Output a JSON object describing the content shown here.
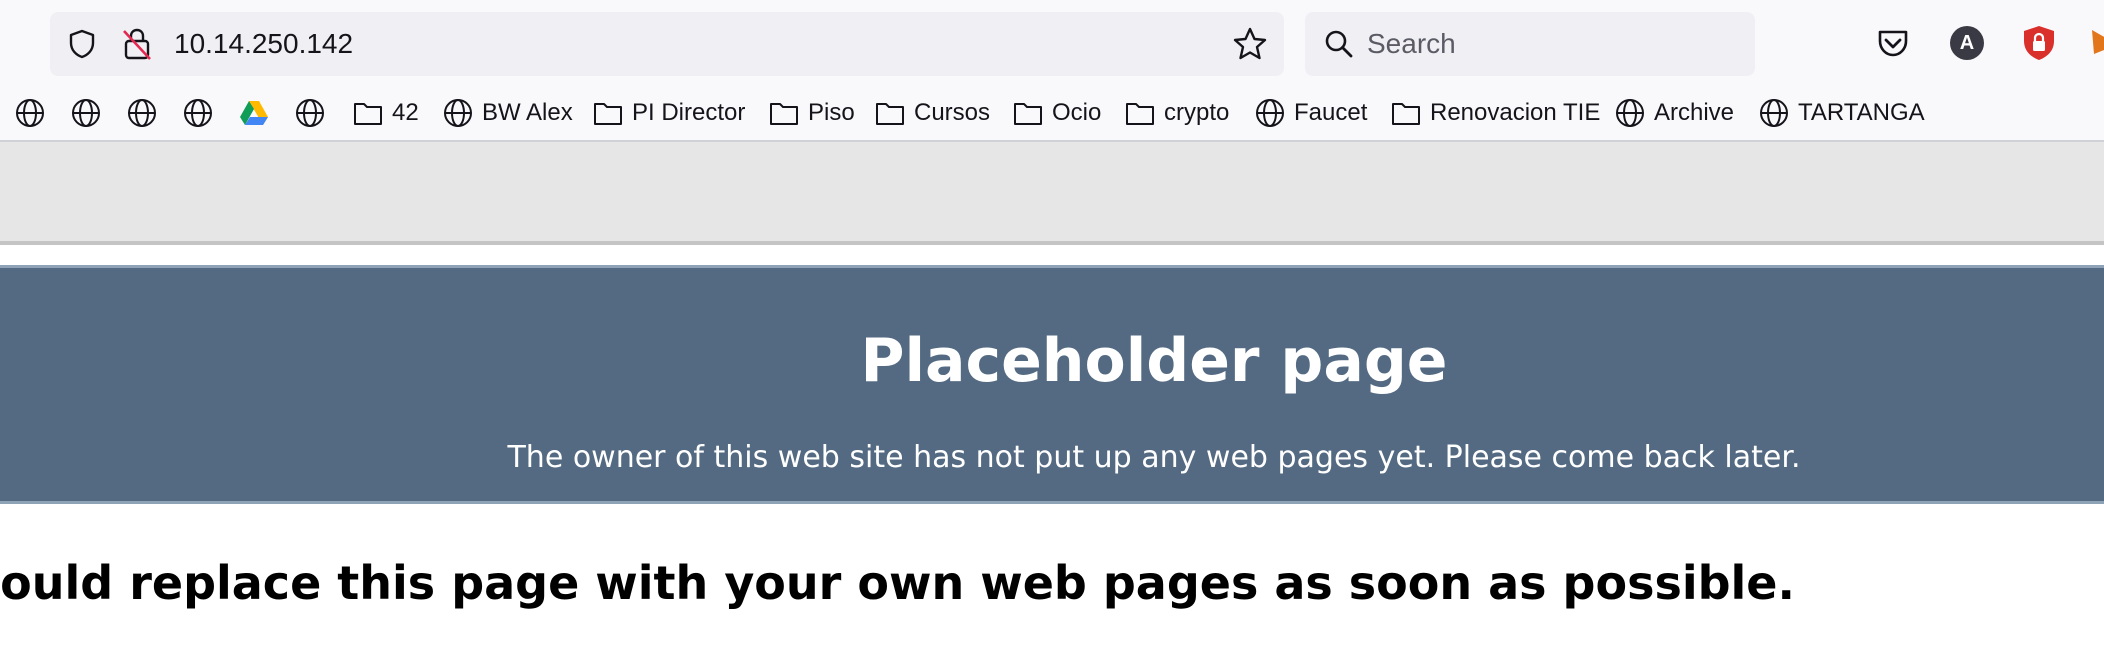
{
  "urlbar": {
    "url": "10.14.250.142"
  },
  "searchbar": {
    "placeholder": "Search"
  },
  "toolbar": {
    "icons": [
      "pocket-icon",
      "account-icon",
      "extension-shield-icon",
      "extension-metamask-icon"
    ],
    "account_initial": "A"
  },
  "bookmarks": {
    "items": [
      {
        "type": "site",
        "label": ""
      },
      {
        "type": "site",
        "label": ""
      },
      {
        "type": "site",
        "label": ""
      },
      {
        "type": "site",
        "label": ""
      },
      {
        "type": "drive",
        "label": ""
      },
      {
        "type": "site",
        "label": ""
      },
      {
        "type": "folder",
        "label": "42"
      },
      {
        "type": "site",
        "label": "BW Alex"
      },
      {
        "type": "folder",
        "label": "PI Director"
      },
      {
        "type": "folder",
        "label": "Piso"
      },
      {
        "type": "folder",
        "label": "Cursos"
      },
      {
        "type": "folder",
        "label": "Ocio"
      },
      {
        "type": "folder",
        "label": "crypto"
      },
      {
        "type": "site",
        "label": "Faucet"
      },
      {
        "type": "folder",
        "label": "Renovacion TIE"
      },
      {
        "type": "site",
        "label": "Archive"
      },
      {
        "type": "site",
        "label": "TARTANGA"
      }
    ]
  },
  "page": {
    "heading": "Placeholder page",
    "subheading": "The owner of this web site has not put up any web pages yet. Please come back later.",
    "body": "should replace this page with your own web pages as soon as possible."
  },
  "colors": {
    "banner": "#536a82",
    "chrome": "#f9f9fb",
    "field": "#f0f0f4",
    "gray_band": "#e6e6e6"
  }
}
